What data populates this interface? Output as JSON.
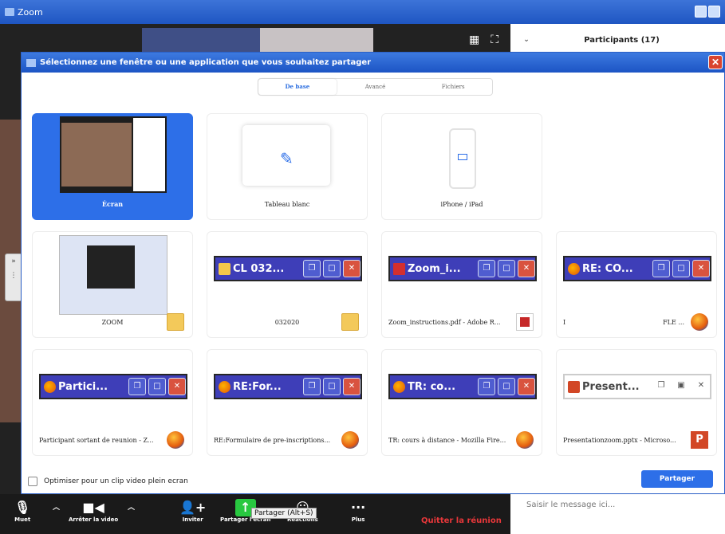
{
  "window": {
    "title": "Zoom"
  },
  "participants": {
    "title": "Participants (17)"
  },
  "chat": {
    "placeholder": "Saisir le message ici..."
  },
  "dialog": {
    "title": "Sélectionnez une fenêtre ou une application que vous souhaitez partager",
    "tabs": [
      "De base",
      "Avancé",
      "Fichiers"
    ],
    "cards": {
      "screen": "Écran",
      "whiteboard": "Tableau blanc",
      "iphone": "iPhone / iPad",
      "zoom": "ZOOM",
      "folder": "032020",
      "pdf": "Zoom_instructions.pdf - Adobe R...",
      "fle_left": "I",
      "fle_right": "FLE ...",
      "participant": "Participant sortant de reunion - Z...",
      "reformulaire": "RE:Formulaire de pre-inscriptions...",
      "tr_cours": "TR: cours à distance - Mozilla Fire...",
      "presentation": "Presentationzoom.pptx - Microso..."
    },
    "thumbs": {
      "folder": "CL 032...",
      "pdf": "Zoom_i...",
      "fle": "RE: CO...",
      "participant": "Partici...",
      "reformulaire": "RE:For...",
      "tr_cours": "TR: co...",
      "presentation": "Present..."
    },
    "optimize_label": "Optimiser pour un clip video plein ecran",
    "share_label": "Partager"
  },
  "toolbar": {
    "mute": "Muet",
    "stop_video": "Arrêter la video",
    "invite": "Inviter",
    "share_screen": "Partager l'écran",
    "reactions": "Réactions",
    "more": "Plus",
    "quit": "Quitter la réunion",
    "tooltip": "Partager (Alt+S)"
  }
}
